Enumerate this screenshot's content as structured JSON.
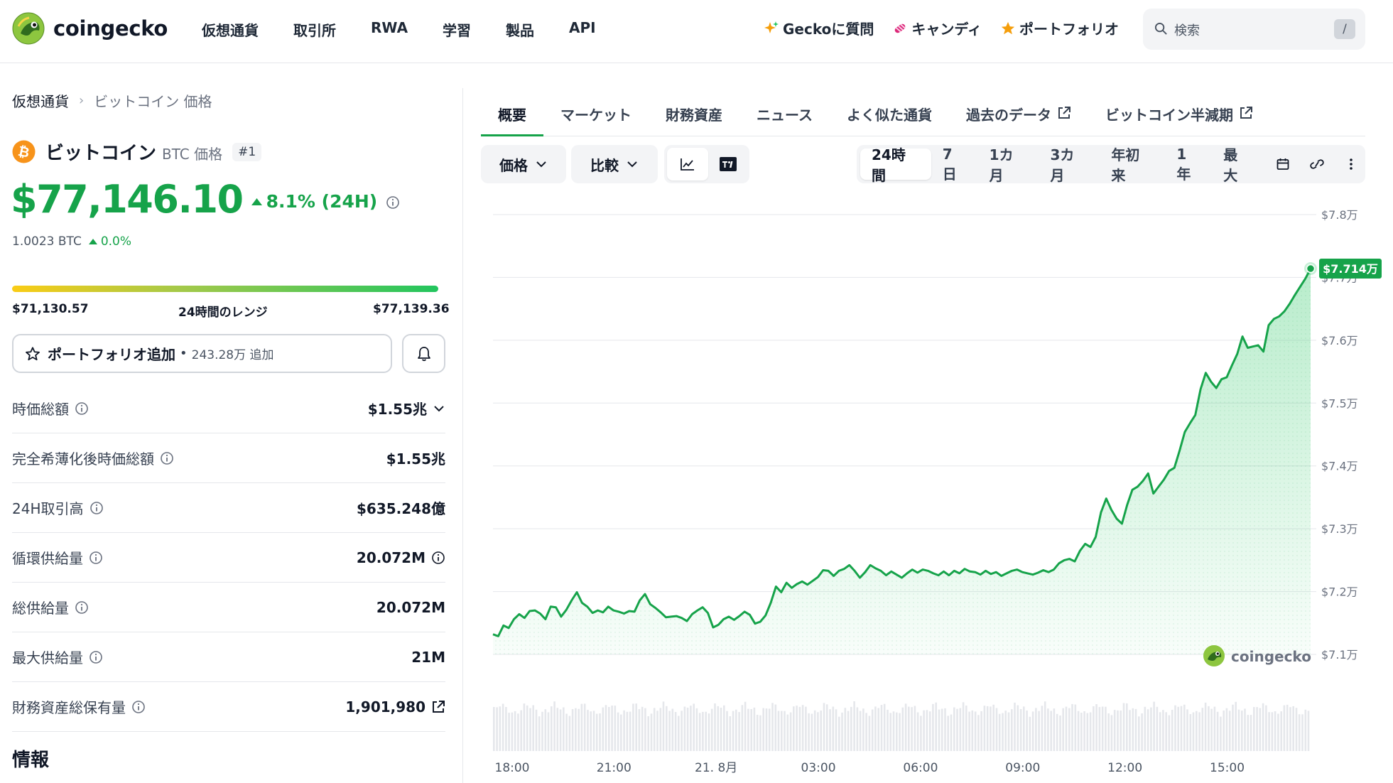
{
  "header": {
    "brand": "coingecko",
    "nav": [
      "仮想通貨",
      "取引所",
      "RWA",
      "学習",
      "製品",
      "API"
    ],
    "ask_gecko": "Geckoに質問",
    "candy": "キャンディ",
    "portfolio": "ポートフォリオ",
    "search_placeholder": "検索",
    "search_shortcut": "/"
  },
  "breadcrumb": {
    "root": "仮想通貨",
    "separator": "›",
    "current": "ビットコイン 価格"
  },
  "coin": {
    "name": "ビットコイン",
    "symbol_label": "BTC 価格",
    "rank": "#1",
    "price": "$77,146.10",
    "change_24h": "8.1% (24H)",
    "btc_price": "1.0023 BTC",
    "btc_change": "0.0%",
    "range_low": "$71,130.57",
    "range_label": "24時間のレンジ",
    "range_high": "$77,139.36",
    "range_position": 1.0
  },
  "portfolio_button": {
    "label": "ポートフォリオ追加",
    "dot": "•",
    "count": "243.28万 追加"
  },
  "stats": [
    {
      "label": "時価総額",
      "value": "$1.55兆",
      "extra": "chevron-down-icon"
    },
    {
      "label": "完全希薄化後時価総額",
      "value": "$1.55兆"
    },
    {
      "label": "24H取引高",
      "value": "$635.248億"
    },
    {
      "label": "循環供給量",
      "value": "20.072M",
      "extra": "info-icon"
    },
    {
      "label": "総供給量",
      "value": "20.072M"
    },
    {
      "label": "最大供給量",
      "value": "21M"
    },
    {
      "label": "財務資産総保有量",
      "value": "1,901,980",
      "extra": "external-link-icon"
    }
  ],
  "info_title": "情報",
  "tabs": [
    "概要",
    "マーケット",
    "財務資産",
    "ニュース",
    "よく似た通貨",
    "過去のデータ",
    "ビットコイン半減期"
  ],
  "controls": {
    "price_label": "価格",
    "compare_label": "比較",
    "ranges": [
      "24時間",
      "7日",
      "1カ月",
      "3カ月",
      "年初来",
      "1年",
      "最大"
    ],
    "active_range": "24時間"
  },
  "colors": {
    "accent": "#16a34a",
    "up": "#16a34a",
    "text": "#111827"
  },
  "chart_data": {
    "type": "area",
    "series": [
      {
        "values": [
          71320,
          71290,
          71460,
          71420,
          71560,
          71640,
          71580,
          71690,
          71700,
          71650,
          71560,
          71760,
          71750,
          71600,
          71710,
          71860,
          71990,
          71820,
          71760,
          71660,
          71700,
          71670,
          71760,
          71700,
          71680,
          71650,
          71690,
          71680,
          71860,
          71960,
          71800,
          71740,
          71670,
          71590,
          71600,
          71610,
          71580,
          71530,
          71640,
          71700,
          71750,
          71660,
          71430,
          71470,
          71560,
          71600,
          71550,
          71610,
          71680,
          71630,
          71490,
          71520,
          71620,
          71820,
          72080,
          71990,
          72140,
          72060,
          72120,
          72160,
          72110,
          72170,
          72230,
          72340,
          72330,
          72250,
          72330,
          72360,
          72420,
          72330,
          72220,
          72310,
          72420,
          72370,
          72330,
          72260,
          72320,
          72270,
          72220,
          72290,
          72350,
          72300,
          72350,
          72330,
          72290,
          72260,
          72320,
          72260,
          72330,
          72290,
          72360,
          72320,
          72310,
          72270,
          72330,
          72280,
          72310,
          72250,
          72290,
          72330,
          72350,
          72310,
          72290,
          72270,
          72300,
          72340,
          72310,
          72350,
          72450,
          72500,
          72520,
          72480,
          72650,
          72760,
          72710,
          72870,
          73260,
          73480,
          73300,
          73160,
          73080,
          73380,
          73620,
          73670,
          73760,
          73880,
          73560,
          73670,
          73780,
          73920,
          73970,
          74240,
          74540,
          74680,
          74810,
          75220,
          75480,
          75340,
          75240,
          75380,
          75410,
          75600,
          75780,
          76060,
          75880,
          75900,
          75920,
          75820,
          76240,
          76340,
          76380,
          76460,
          76580,
          76720,
          76850,
          76980,
          77140
        ]
      }
    ],
    "x_ticks": [
      "18:00",
      "21:00",
      "21. 8月",
      "03:00",
      "06:00",
      "09:00",
      "12:00",
      "15:00"
    ],
    "y_ticks": [
      "$7.8万",
      "$7.7万",
      "$7.6万",
      "$7.5万",
      "$7.4万",
      "$7.3万",
      "$7.2万",
      "$7.1万"
    ],
    "ylim": [
      71000,
      78000
    ],
    "last_label": "$7.714万",
    "watermark": "coingecko",
    "grid": true,
    "volume_bars": true
  }
}
